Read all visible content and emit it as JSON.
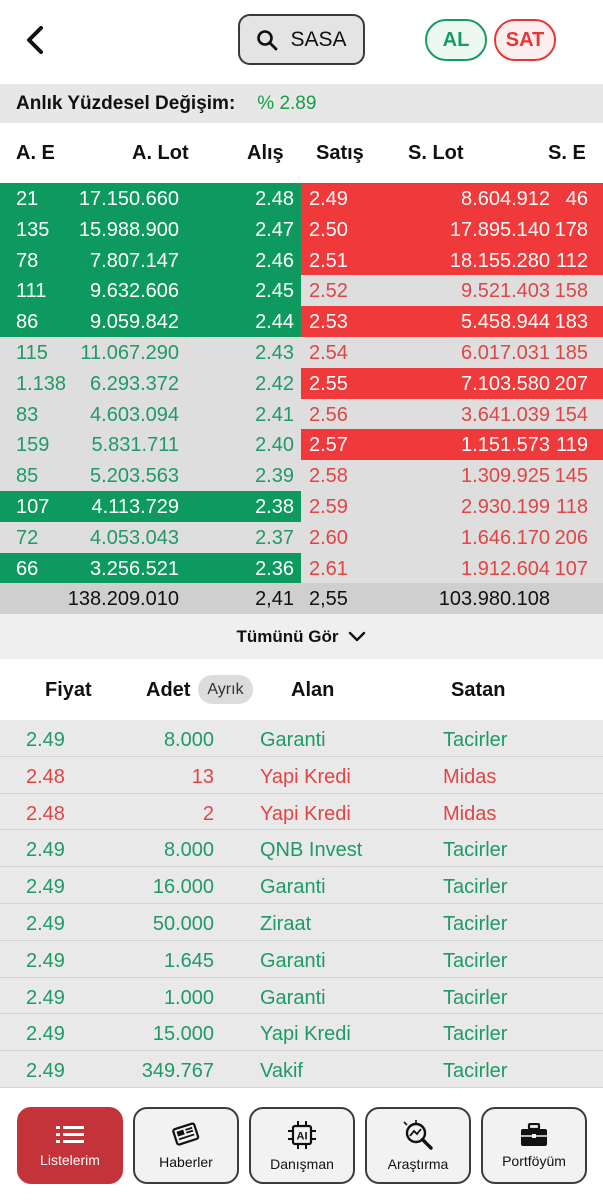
{
  "header": {
    "back_icon": "chevron-left-icon",
    "symbol": "SASA",
    "buy_label": "AL",
    "sell_label": "SAT"
  },
  "change": {
    "label": "Anlık Yüzdesel Değişim:",
    "value": "% 2.89"
  },
  "depth": {
    "columns": [
      "A. E",
      "A. Lot",
      "Alış",
      "Satış",
      "S. Lot",
      "S. E"
    ],
    "rows": [
      {
        "ae": "21",
        "alot": "17.150.660",
        "alis": "2.48",
        "satis": "2.49",
        "slot": "8.604.912",
        "se": "46"
      },
      {
        "ae": "135",
        "alot": "15.988.900",
        "alis": "2.47",
        "satis": "2.50",
        "slot": "17.895.140",
        "se": "178"
      },
      {
        "ae": "78",
        "alot": "7.807.147",
        "alis": "2.46",
        "satis": "2.51",
        "slot": "18.155.280",
        "se": "112"
      },
      {
        "ae": "111",
        "alot": "9.632.606",
        "alis": "2.45",
        "satis": "2.52",
        "slot": "9.521.403",
        "se": "158"
      },
      {
        "ae": "86",
        "alot": "9.059.842",
        "alis": "2.44",
        "satis": "2.53",
        "slot": "5.458.944",
        "se": "183"
      },
      {
        "ae": "115",
        "alot": "11.067.290",
        "alis": "2.43",
        "satis": "2.54",
        "slot": "6.017.031",
        "se": "185"
      },
      {
        "ae": "1.138",
        "alot": "6.293.372",
        "alis": "2.42",
        "satis": "2.55",
        "slot": "7.103.580",
        "se": "207"
      },
      {
        "ae": "83",
        "alot": "4.603.094",
        "alis": "2.41",
        "satis": "2.56",
        "slot": "3.641.039",
        "se": "154"
      },
      {
        "ae": "159",
        "alot": "5.831.711",
        "alis": "2.40",
        "satis": "2.57",
        "slot": "1.151.573",
        "se": "119"
      },
      {
        "ae": "85",
        "alot": "5.203.563",
        "alis": "2.39",
        "satis": "2.58",
        "slot": "1.309.925",
        "se": "145"
      },
      {
        "ae": "107",
        "alot": "4.113.729",
        "alis": "2.38",
        "satis": "2.59",
        "slot": "2.930.199",
        "se": "118"
      },
      {
        "ae": "72",
        "alot": "4.053.043",
        "alis": "2.37",
        "satis": "2.60",
        "slot": "1.646.170",
        "se": "206"
      },
      {
        "ae": "66",
        "alot": "3.256.521",
        "alis": "2.36",
        "satis": "2.61",
        "slot": "1.912.604",
        "se": "107"
      }
    ],
    "totals": {
      "alot": "138.209.010",
      "alis": "2,41",
      "satis": "2,55",
      "slot": "103.980.108"
    }
  },
  "see_all": {
    "label": "Tümünü Gör",
    "icon": "chevron-down-icon"
  },
  "trades": {
    "columns": {
      "price": "Fiyat",
      "qty": "Adet",
      "qty_toggle": "Ayrık",
      "buyer": "Alan",
      "seller": "Satan"
    },
    "rows": [
      {
        "price": "2.49",
        "qty": "8.000",
        "buyer": "Garanti",
        "seller": "Tacirler"
      },
      {
        "price": "2.48",
        "qty": "13",
        "buyer": "Yapi Kredi",
        "seller": "Midas"
      },
      {
        "price": "2.48",
        "qty": "2",
        "buyer": "Yapi Kredi",
        "seller": "Midas"
      },
      {
        "price": "2.49",
        "qty": "8.000",
        "buyer": "QNB Invest",
        "seller": "Tacirler"
      },
      {
        "price": "2.49",
        "qty": "16.000",
        "buyer": "Garanti",
        "seller": "Tacirler"
      },
      {
        "price": "2.49",
        "qty": "50.000",
        "buyer": "Ziraat",
        "seller": "Tacirler"
      },
      {
        "price": "2.49",
        "qty": "1.645",
        "buyer": "Garanti",
        "seller": "Tacirler"
      },
      {
        "price": "2.49",
        "qty": "1.000",
        "buyer": "Garanti",
        "seller": "Tacirler"
      },
      {
        "price": "2.49",
        "qty": "15.000",
        "buyer": "Yapi Kredi",
        "seller": "Tacirler"
      },
      {
        "price": "2.49",
        "qty": "349.767",
        "buyer": "Vakif",
        "seller": "Tacirler"
      }
    ]
  },
  "bottom_nav": [
    {
      "label": "Listelerim",
      "icon": "list-icon",
      "active": true
    },
    {
      "label": "Haberler",
      "icon": "newspaper-icon",
      "active": false
    },
    {
      "label": "Danışman",
      "icon": "ai-chip-icon",
      "active": false
    },
    {
      "label": "Araştırma",
      "icon": "research-magnifier-icon",
      "active": false
    },
    {
      "label": "Portföyüm",
      "icon": "briefcase-icon",
      "active": false
    }
  ],
  "colors": {
    "bid_fill": "#0e9a5e",
    "ask_fill": "#f0393a",
    "up_text": "#1f9a66",
    "down_text": "#e04545",
    "active_nav": "#c4323a"
  }
}
